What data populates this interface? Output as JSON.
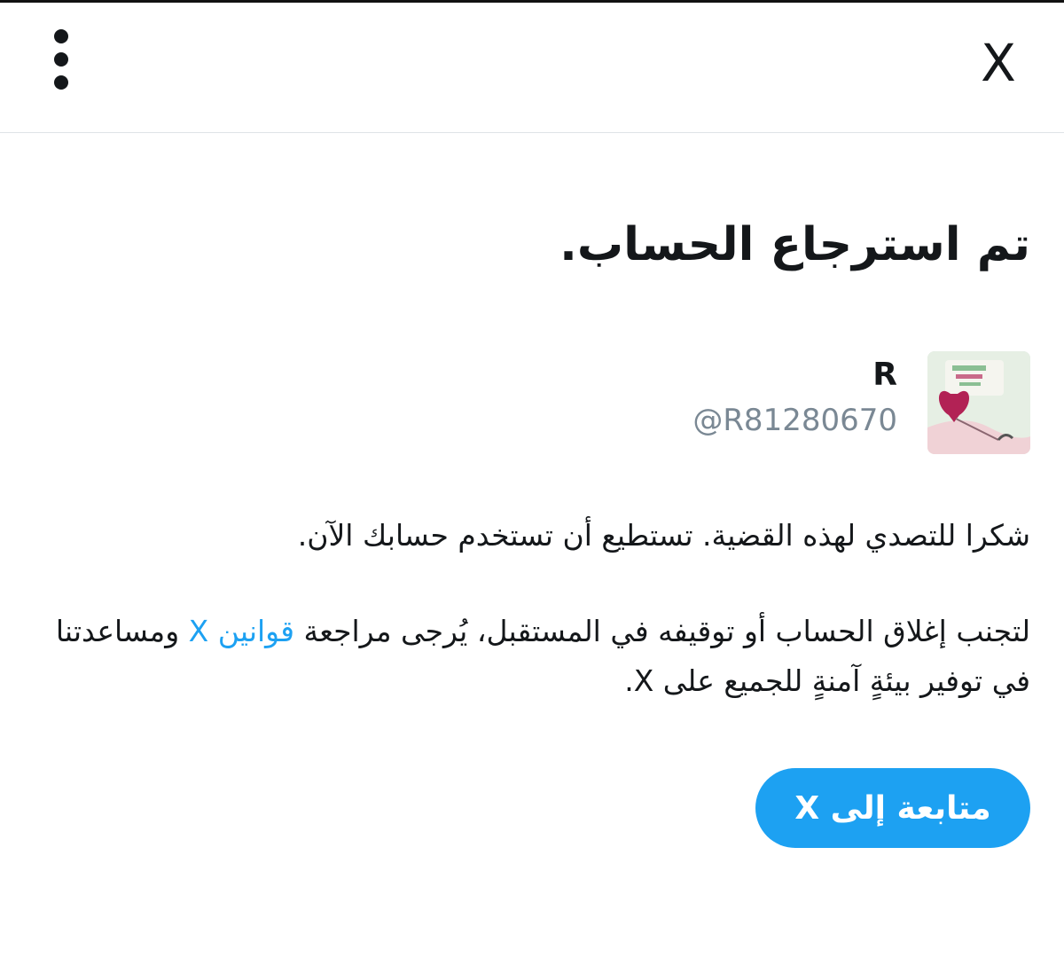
{
  "header": {
    "close_label": "X",
    "more_icon": "more-vertical-icon",
    "close_icon": "close-x-icon"
  },
  "main": {
    "title": "تم استرجاع الحساب.",
    "account": {
      "name": "R",
      "handle": "@R81280670",
      "avatar_icon": "profile-avatar-image"
    },
    "message": "شكرا للتصدي لهذه القضية. تستطيع أن تستخدم حسابك الآن.",
    "rules_before": "لتجنب إغلاق الحساب أو توقيفه في المستقبل، يُرجى مراجعة ",
    "rules_link": "قوانين X",
    "rules_after": " ومساعدتنا في توفير بيئةٍ آمنةٍ للجميع على X.",
    "continue_button": "متابعة إلى X"
  },
  "colors": {
    "accent": "#1da1f2",
    "text": "#14171a",
    "muted": "#7a8894",
    "divider": "#dfe3e7"
  }
}
